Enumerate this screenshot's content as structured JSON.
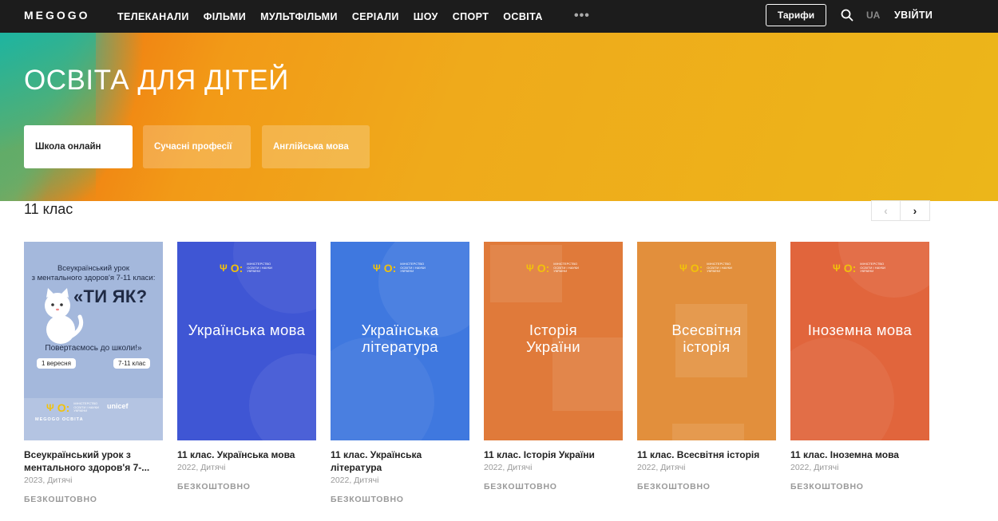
{
  "header": {
    "logo": "MEGOGO",
    "nav": [
      "ТЕЛЕКАНАЛИ",
      "ФІЛЬМИ",
      "МУЛЬТФІЛЬМИ",
      "СЕРІАЛИ",
      "ШОУ",
      "СПОРТ",
      "ОСВІТА"
    ],
    "more": "•••",
    "tariffs": "Тарифи",
    "lang": "UA",
    "login": "УВІЙТИ"
  },
  "banner": {
    "title": "ОСВІТА ДЛЯ ДІТЕЙ",
    "pills": [
      "Школа онлайн",
      "Сучасні професії",
      "Англійська мова"
    ]
  },
  "section": {
    "title": "11 клас",
    "prev": "‹",
    "next": "›"
  },
  "poster1": {
    "line1": "Всеукраїнський урок",
    "line2": "з ментального здоров'я 7-11 класи:",
    "big": "«ТИ ЯК?",
    "back": "Повертаємось до школи!»",
    "badge_left": "1 вересня",
    "badge_right": "7-11 клас",
    "unicef": "unicef",
    "megogo": "MEGOGO ОСВІТА"
  },
  "ministry": {
    "mark": "Ψ",
    "oo": "O:",
    "text": "МІНІСТЕРСТВО ОСВІТИ І НАУКИ УКРАЇНИ"
  },
  "cards": [
    {
      "poster_title": "",
      "name": "Всеукраїнський урок з ментального здоров'я 7-...",
      "meta": "2023, Дитячі",
      "price": "БЕЗКОШТОВНО"
    },
    {
      "poster_title": "Українська мова",
      "name": "11 клас. Українська мова",
      "meta": "2022, Дитячі",
      "price": "БЕЗКОШТОВНО",
      "color": "#3f56d4"
    },
    {
      "poster_title": "Українська література",
      "name": "11 клас. Українська література",
      "meta": "2022, Дитячі",
      "price": "БЕЗКОШТОВНО",
      "color": "#3f78df"
    },
    {
      "poster_title": "Історія України",
      "name": "11 клас. Історія України",
      "meta": "2022, Дитячі",
      "price": "БЕЗКОШТОВНО",
      "color": "#e07a3a"
    },
    {
      "poster_title": "Всесвітня історія",
      "name": "11 клас. Всесвітня історія",
      "meta": "2022, Дитячі",
      "price": "БЕЗКОШТОВНО",
      "color": "#e28f3c"
    },
    {
      "poster_title": "Іноземна мова",
      "name": "11 клас. Іноземна мова",
      "meta": "2022, Дитячі",
      "price": "БЕЗКОШТОВНО",
      "color": "#e1653c"
    }
  ]
}
